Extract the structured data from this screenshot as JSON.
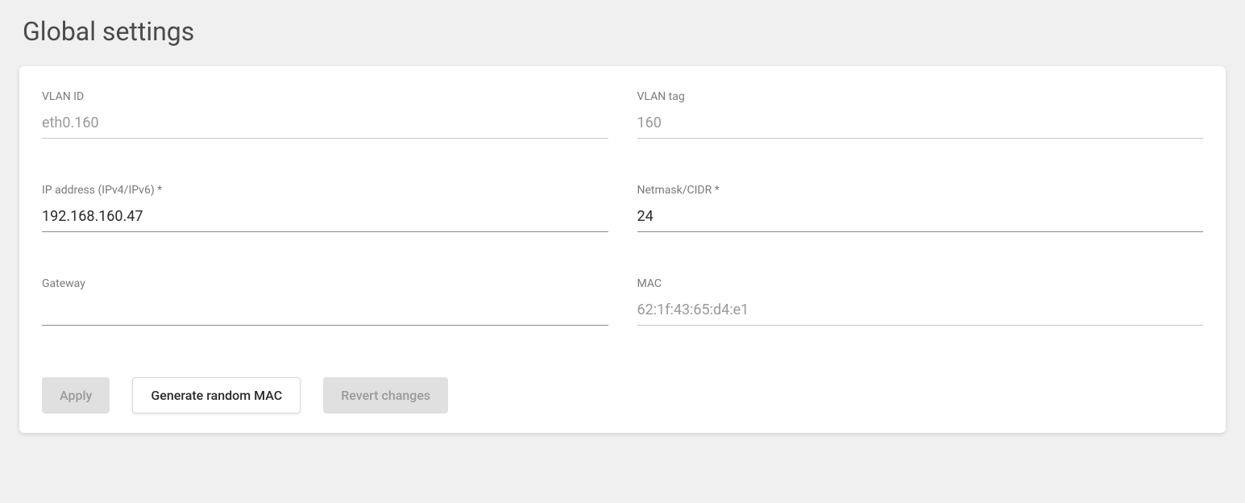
{
  "title": "Global settings",
  "fields": {
    "vlan_id": {
      "label": "VLAN ID",
      "value": "eth0.160"
    },
    "vlan_tag": {
      "label": "VLAN tag",
      "value": "160"
    },
    "ip_address": {
      "label": "IP address (IPv4/IPv6) *",
      "value": "192.168.160.47"
    },
    "netmask": {
      "label": "Netmask/CIDR *",
      "value": "24"
    },
    "gateway": {
      "label": "Gateway",
      "value": ""
    },
    "mac": {
      "label": "MAC",
      "value": "62:1f:43:65:d4:e1"
    }
  },
  "buttons": {
    "apply": "Apply",
    "generate_mac": "Generate random MAC",
    "revert": "Revert changes"
  }
}
